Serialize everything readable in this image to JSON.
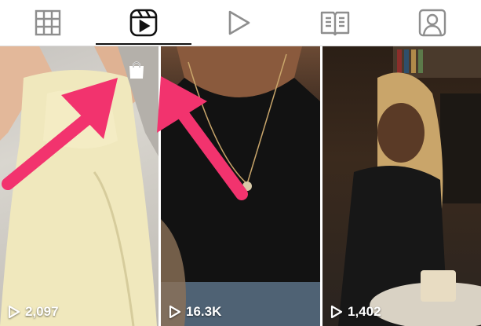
{
  "tabs": [
    {
      "icon": "grid-icon",
      "active": false
    },
    {
      "icon": "reels-icon",
      "active": true
    },
    {
      "icon": "play-icon",
      "active": false
    },
    {
      "icon": "guides-icon",
      "active": false
    },
    {
      "icon": "tagged-icon",
      "active": false
    }
  ],
  "reels": [
    {
      "views": "2,097",
      "shoppable": true
    },
    {
      "views": "16.3K",
      "shoppable": false
    },
    {
      "views": "1,402",
      "shoppable": false
    }
  ],
  "colors": {
    "accent_arrow": "#f2336e",
    "active_tab": "#111111",
    "inactive_icon": "#8e8e8e"
  }
}
